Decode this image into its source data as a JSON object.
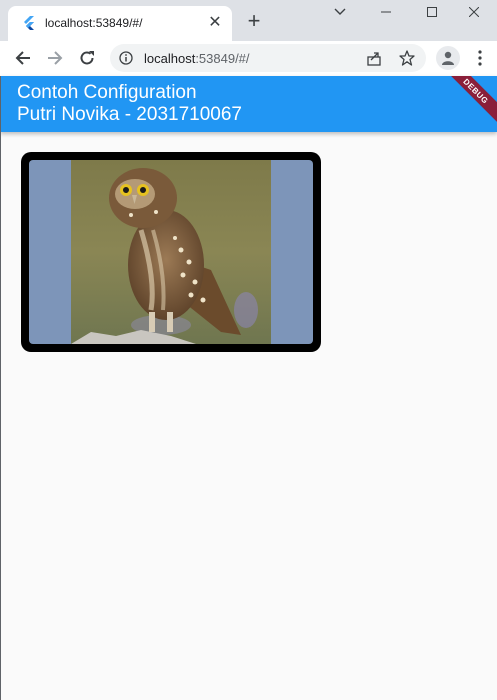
{
  "browser": {
    "tab": {
      "title": "localhost:53849/#/",
      "favicon": "flutter-logo-icon"
    },
    "new_tab": "+",
    "url": {
      "host": "localhost",
      "rest": ":53849/#/"
    },
    "window_controls": [
      "chevron-down-icon",
      "minimize-icon",
      "maximize-icon",
      "close-icon"
    ]
  },
  "app": {
    "title_line1": "Contoh Configuration",
    "title_line2": "Putri Novika - 2031710067",
    "debug_banner": "DEBUG",
    "colors": {
      "appbar": "#2196f3",
      "background": "#fafafa",
      "image_border": "#000000",
      "image_fill": "#7d95b9",
      "debug_banner": "#8a1f3a"
    },
    "image": {
      "subject": "owl-photo"
    }
  }
}
